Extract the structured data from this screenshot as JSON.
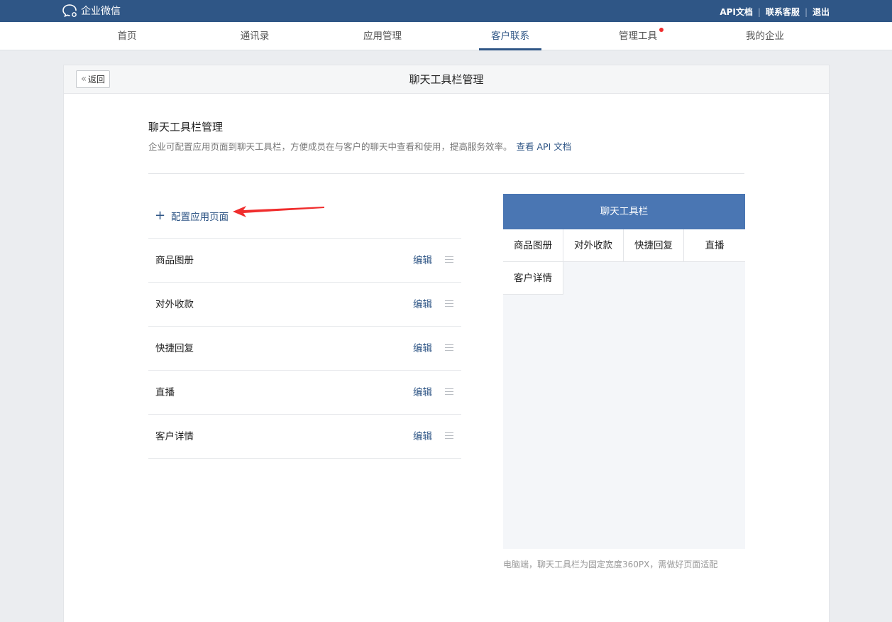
{
  "header": {
    "logo_text": "企业微信",
    "links": [
      "API文档",
      "联系客服",
      "退出"
    ],
    "separator": "|"
  },
  "nav": {
    "items": [
      {
        "label": "首页"
      },
      {
        "label": "通讯录"
      },
      {
        "label": "应用管理"
      },
      {
        "label": "客户联系"
      },
      {
        "label": "管理工具"
      },
      {
        "label": "我的企业"
      }
    ],
    "active": "客户联系"
  },
  "page": {
    "back_label": "返回",
    "title": "聊天工具栏管理",
    "section_title": "聊天工具栏管理",
    "section_desc": "企业可配置应用页面到聊天工具栏，方便成员在与客户的聊天中查看和使用，提高服务效率。",
    "api_link": "查看 API 文档",
    "add_label": "配置应用页面",
    "items": [
      {
        "name": "商品图册",
        "edit": "编辑"
      },
      {
        "name": "对外收款",
        "edit": "编辑"
      },
      {
        "name": "快捷回复",
        "edit": "编辑"
      },
      {
        "name": "直播",
        "edit": "编辑"
      },
      {
        "name": "客户详情",
        "edit": "编辑"
      }
    ]
  },
  "preview": {
    "header": "聊天工具栏",
    "tabs": [
      "商品图册",
      "对外收款",
      "快捷回复",
      "直播",
      "客户详情"
    ],
    "note": "电脑端，聊天工具栏为固定宽度360PX，需做好页面适配"
  },
  "colors": {
    "brand": "#2f5686",
    "preview_header": "#4a76b3",
    "notification_dot": "#f02d2d",
    "annotation_arrow": "#f02d2d"
  }
}
